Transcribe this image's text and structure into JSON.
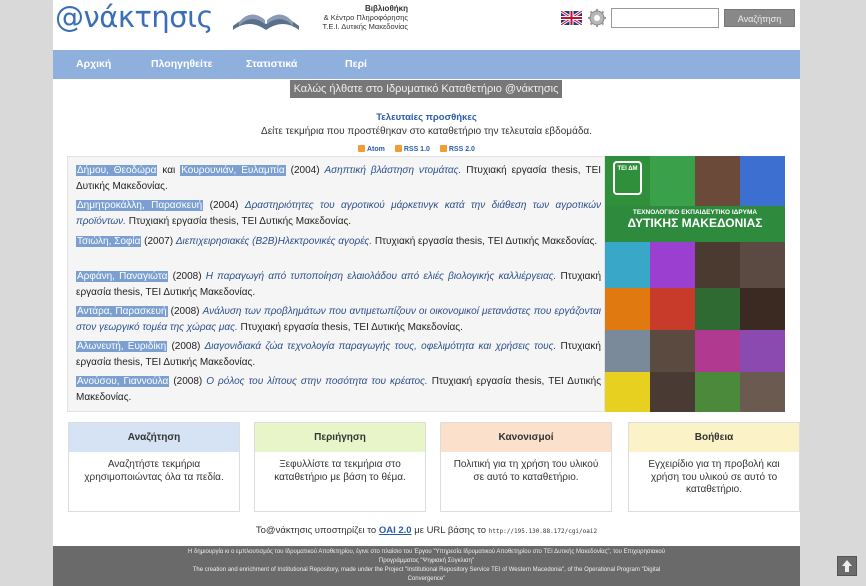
{
  "header": {
    "logo": "@νάκτησις",
    "library_line1": "Βιβλιοθήκη",
    "library_line2": "& Κέντρο Πληροφόρησης",
    "library_line3": "Τ.Ε.Ι. Δυτικής Μακεδονίας",
    "search_value": "",
    "search_button": "Αναζήτηση"
  },
  "nav": {
    "home": "Αρχική",
    "browse": "Πλοηγηθείτε",
    "stats": "Στατιστικά",
    "about": "Περί"
  },
  "welcome": "Καλώς ήλθατε στο Ιδρυματικό Καταθετήριο @νάκτησις",
  "recent": {
    "title": "Τελευταίες προσθήκες",
    "subtitle": "Δείτε τεκμήρια που προστέθηκαν στο καταθετήριο την τελευταία εβδομάδα.",
    "feeds": [
      "Atom",
      "RSS 1.0",
      "RSS 2.0"
    ],
    "items": [
      {
        "authors": [
          "Δήμου, Θεοδώρα",
          "Κουρουνιάν, Ευλαμπία"
        ],
        "joiner": "και",
        "year": "(2004)",
        "title": "Ασηπτική βλάστηση ντομάτας.",
        "rest": "Πτυχιακή εργασία thesis, ΤΕΙ Δυτικής Μακεδονίας."
      },
      {
        "authors": [
          "Δημητροκάλλη, Παρασκευή"
        ],
        "year": "(2004)",
        "title": "Δραστηριότητες του αγροτικού μάρκετινγκ κατά την διάθεση των αγροτικών προϊόντων.",
        "rest": "Πτυχιακή εργασία thesis, ΤΕΙ Δυτικής Μακεδονίας."
      },
      {
        "authors": [
          "Τσιώλη, Σοφία"
        ],
        "year": "(2007)",
        "title": "Διεπιχειρησιακές (B2B)Ηλεκτρονικές αγορές.",
        "rest": "Πτυχιακή εργασία thesis, ΤΕΙ Δυτικής Μακεδονίας."
      },
      {
        "authors": [
          "Αρφάνη, Παναγιώτα"
        ],
        "year": "(2008)",
        "title": "Η παραγωγή από τυποποίηση ελαιολάδου από ελιές βιολογικής καλλιέργειας.",
        "rest": "Πτυχιακή εργασία thesis, ΤΕΙ Δυτικής Μακεδονίας."
      },
      {
        "authors": [
          "Αντάρα, Παρασκευή"
        ],
        "year": "(2008)",
        "title": "Ανάλυση των προβλημάτων που αντιμετωπίζουν οι οικονομικοί μετανάστες που εργάζονται στον γεωργικό τομέα της χώρας μας.",
        "rest": "Πτυχιακή εργασία thesis, ΤΕΙ Δυτικής Μακεδονίας."
      },
      {
        "authors": [
          "Αλωνευτή, Ευριδίκη"
        ],
        "year": "(2008)",
        "title": "Διαγονιδιακά ζώα τεχνολογία παραγωγής τους, οφελιμότητα και χρήσεις τους.",
        "rest": "Πτυχιακή εργασία thesis, ΤΕΙ Δυτικής Μακεδονίας."
      },
      {
        "authors": [
          "Ανούσου, Γιαννούλα"
        ],
        "year": "(2008)",
        "title": "Ο ρόλος του λίπους στην ποσότητα του κρέατος.",
        "rest": "Πτυχιακή εργασία thesis, ΤΕΙ Δυτικής Μακεδονίας."
      }
    ]
  },
  "collage": {
    "badge": "ΤΕΙ ΔΜ",
    "banner_line1": "ΤΕΧΝΟΛΟΓΙΚΟ ΕΚΠΑΙΔΕΥΤΙΚΟ ΙΔΡΥΜΑ",
    "banner_line2": "ΔΥΤΙΚΗΣ ΜΑΚΕΔΟΝΙΑΣ"
  },
  "boxes": [
    {
      "title": "Αναζήτηση",
      "text": "Αναζητήστε τεκμήρια χρησιμοποιώντας όλα τα πεδία.",
      "color": "#d6e3f5"
    },
    {
      "title": "Περιήγηση",
      "text": "Ξεφυλλίστε τα τεκμήρια στο καταθετήριο με βάση το θέμα.",
      "color": "#e8f5c8"
    },
    {
      "title": "Κανονισμοί",
      "text": "Πολιτική για τη χρήση του υλικού σε αυτό το καταθετήριο.",
      "color": "#fbe0cc"
    },
    {
      "title": "Βοήθεια",
      "text": "Εγχειρίδιο για τη προβολή και χρήση του υλικού σε αυτό το καταθετήριο.",
      "color": "#fbf2c8"
    }
  ],
  "oai": {
    "prefix": "Το@νάκτησις υποστηρίζει το",
    "link": "OAI 2.0",
    "mid": "με URL βάσης το",
    "url": "http://195.130.88.172/cgi/oai2"
  },
  "footer": {
    "line1": "Η δημιουργία κι ο εμπλουτισμός του Ιδρυματικού Αποθετηρίου, έγινε στο πλαίσιο του Έργου \"Υπηρεσία Ιδρυματικού Αποθετηρίου στο ΤΕΙ Δυτικής Μακεδονίας\", του Επιχειρησιακού",
    "line2": "Προγράμματος \"Ψηφιακή Σύγκλιση\"",
    "line3": "The creation and enrichment of Institutional Repository, made under the Project \"Institutional Repository Service TEI of Western Macedonia\", of the Operational Program \"Digital",
    "line4": "Convergence\""
  }
}
